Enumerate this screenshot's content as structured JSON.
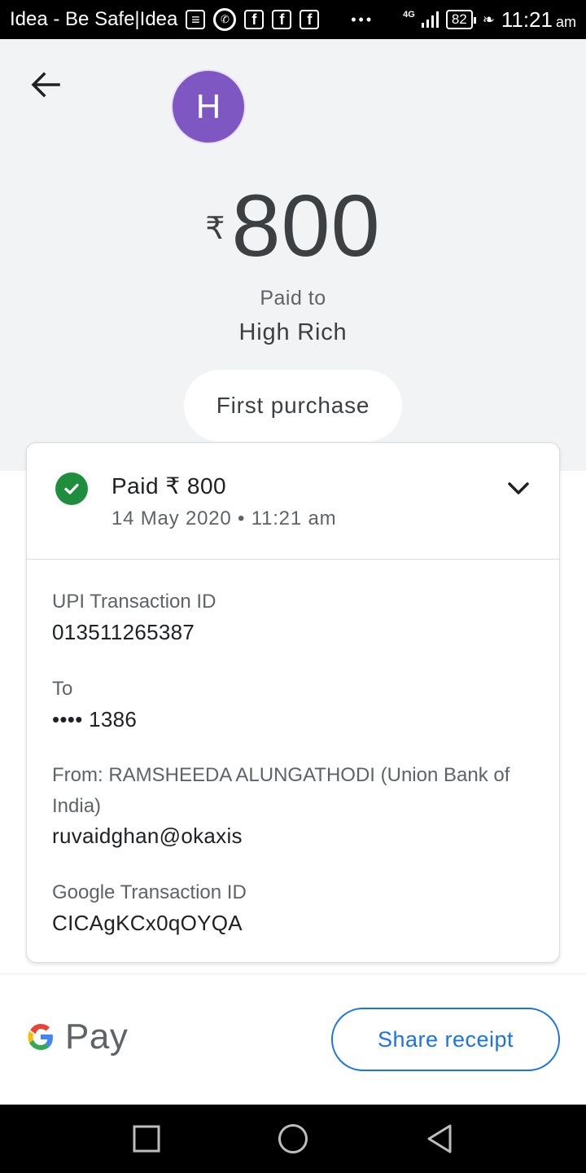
{
  "status_bar": {
    "carrier": "Idea - Be Safe|Idea",
    "network": "4G",
    "battery": "82",
    "time": "11:21",
    "ampm": "am"
  },
  "header": {
    "avatar_letter": "H",
    "avatar_color": "#7e57c2",
    "currency": "₹",
    "amount": "800",
    "paid_to_label": "Paid to",
    "payee": "High Rich",
    "note": "First purchase"
  },
  "card": {
    "status_title": "Paid ₹ 800",
    "status_date": "14 May 2020 • 11:21 am",
    "status_color": "#1e8e3e",
    "details": [
      {
        "label": "UPI Transaction ID",
        "value": "013511265387"
      },
      {
        "label": "To",
        "value": "•••• 1386"
      },
      {
        "label": "From: RAMSHEEDA  ALUNGATHODI (Union Bank of India)",
        "value": "ruvaidghan@okaxis"
      },
      {
        "label": "Google Transaction ID",
        "value": "CICAgKCx0qOYQA"
      }
    ]
  },
  "footer": {
    "logo_text": "Pay",
    "share_label": "Share receipt",
    "accent_color": "#1a73e8"
  },
  "icons": {
    "back": "arrow-left-icon",
    "check": "check-circle-icon",
    "expand": "chevron-down-icon",
    "nav_recents": "square-icon",
    "nav_home": "circle-icon",
    "nav_back": "triangle-back-icon"
  }
}
